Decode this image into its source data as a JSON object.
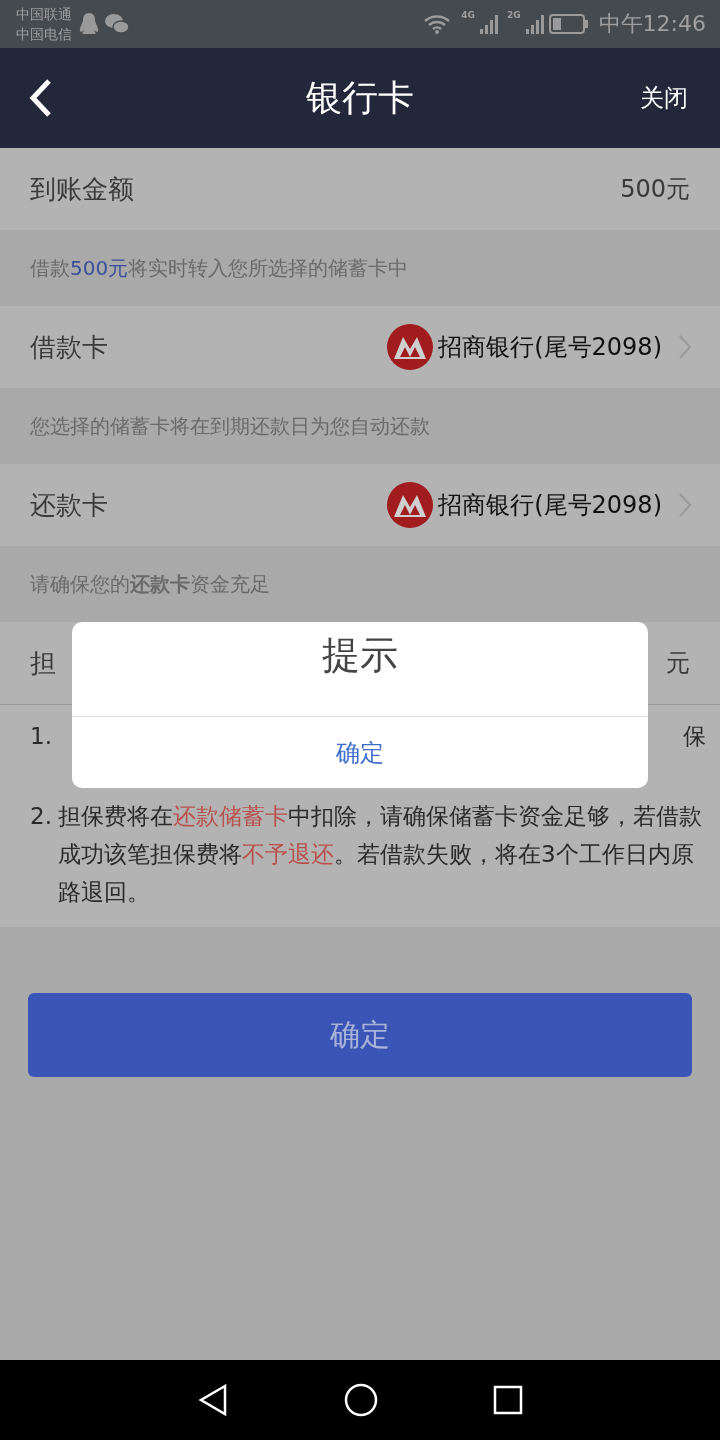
{
  "status_bar": {
    "carriers": [
      "中国联通",
      "中国电信"
    ],
    "network_labels": [
      "4G",
      "2G"
    ],
    "time": "中午12:46"
  },
  "header": {
    "title": "银行卡",
    "close": "关闭"
  },
  "amount_row": {
    "label": "到账金额",
    "value": "500元"
  },
  "hint_1": [
    {
      "kind": "plain",
      "text": "借款"
    },
    {
      "kind": "highlight",
      "text": "500元"
    },
    {
      "kind": "plain",
      "text": "将实时转入您所选择的储蓄卡中"
    }
  ],
  "loan_card": {
    "label": "借款卡",
    "bank": "招商银行(尾号2098)"
  },
  "hint_2": "您选择的储蓄卡将在到期还款日为您自动还款",
  "repay_card": {
    "label": "还款卡",
    "bank": "招商银行(尾号2098)"
  },
  "hint_3": "请确保您的**还款卡**资金充足",
  "fee_row": {
    "label": "担",
    "value": "元"
  },
  "notes": [
    {
      "number": "1.",
      "line_end": "保"
    },
    {
      "number": "2.",
      "segments": [
        {
          "kind": "plain",
          "text": "担保费将在"
        },
        {
          "kind": "warning",
          "text": "还款储蓄卡"
        },
        {
          "kind": "plain",
          "text": "中扣除，请确保储蓄卡资金足够，若借款成功该笔担保费将"
        },
        {
          "kind": "warning",
          "text": "不予退还"
        },
        {
          "kind": "plain",
          "text": "。若借款失败，将在3个工作日内原路退回。"
        }
      ]
    }
  ],
  "confirm_button": "确定",
  "dialog": {
    "title": "提示",
    "button": "确定"
  }
}
